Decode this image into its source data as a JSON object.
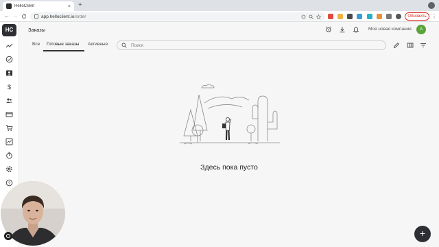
{
  "browser": {
    "tab_title": "HelloClient",
    "tab_close": "×",
    "new_tab": "+",
    "back": "←",
    "forward": "→",
    "reload": "C",
    "url_host": "app.helloclient.io",
    "url_path": "/order",
    "update_label": "Обновить",
    "menu": "⋮",
    "window_control": "●"
  },
  "app": {
    "logo": "HC",
    "page_title": "Заказы",
    "company": "Моя новая компания",
    "avatar_letter": "A",
    "accent_color": "#2e2f35",
    "avatar_color": "#5aa33a"
  },
  "filter_tabs": [
    {
      "label": "Все"
    },
    {
      "label": "Готовые заказы"
    },
    {
      "label": "Активные"
    }
  ],
  "search": {
    "placeholder": "Поиск"
  },
  "empty_state": {
    "message": "Здесь пока пусто"
  },
  "fab": {
    "label": "+"
  },
  "sidebar_icons": [
    "trend-icon",
    "check-circle-icon",
    "contacts-icon",
    "dollar-icon",
    "users-icon",
    "card-icon",
    "cart-icon",
    "chart-icon",
    "timer-icon",
    "settings-icon",
    "help-icon"
  ]
}
